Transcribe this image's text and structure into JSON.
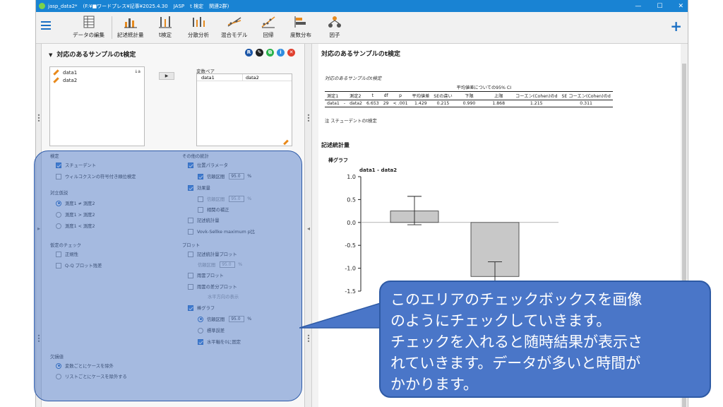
{
  "window": {
    "title_items": [
      "jasp_data2*",
      "(F:¥■ワードプレス¥記事¥2025.4.30",
      "JASP",
      "t 検定",
      "関連2群)"
    ],
    "controls": [
      "—",
      "☐",
      "✕"
    ]
  },
  "toolbar": {
    "items": [
      {
        "label": "データの編集",
        "icon": "data-edit-icon"
      },
      {
        "label": "記述統計量",
        "icon": "descriptives-icon"
      },
      {
        "label": "t検定",
        "icon": "ttest-icon"
      },
      {
        "label": "分散分析",
        "icon": "anova-icon"
      },
      {
        "label": "混合モデル",
        "icon": "mixed-model-icon"
      },
      {
        "label": "回帰",
        "icon": "regression-icon"
      },
      {
        "label": "度数分布",
        "icon": "frequencies-icon"
      },
      {
        "label": "因子",
        "icon": "factor-icon"
      }
    ],
    "plus": "+"
  },
  "analysis": {
    "title": "対応のあるサンプルのt検定",
    "header_icons": [
      "R",
      "✎",
      "⧉",
      "i",
      "✕"
    ],
    "variables": [
      "data1",
      "data2"
    ],
    "pair_label": "変数ペア",
    "pair": [
      "data1",
      "data2"
    ],
    "arrow": "▶",
    "sort_icon": "↓a"
  },
  "options": {
    "test_title": "検定",
    "student": "スチューデント",
    "wilcoxon": "ウィルコクスンの符号付き順位検定",
    "alt_title": "対立仮説",
    "alt1": "測度1 ≠ 測度2",
    "alt2": "測度1 > 測度2",
    "alt3": "測度1 < 測度2",
    "assump_title": "仮定のチェック",
    "normality": "正規性",
    "qq": "Q-Q プロット残差",
    "other_title": "その他の統計",
    "location": "位置パラメータ",
    "ci": "信頼区間",
    "ci_value": "95.0",
    "percent": "%",
    "effect": "効果量",
    "effect_ci": "信頼区間",
    "effect_ci_value": "95.0",
    "corr": "相関の補正",
    "descriptives": "記述統計量",
    "vovk": "Vovk-Sellke maximum p比",
    "plot_title": "プロット",
    "desc_plot": "記述統計量プロット",
    "desc_ci": "信頼区間",
    "desc_ci_value": "95.0",
    "raincloud": "雨雲プロット",
    "raincloud_diff": "雨雲の差分プロット",
    "horizontal": "水平方向の表示",
    "bar": "棒グラフ",
    "bar_ci": "信頼区間",
    "bar_ci_value": "95.0",
    "se": "標準誤差",
    "fix_axis": "水平軸を0に固定",
    "missing_title": "欠損値",
    "miss1": "変数ごとにケースを除外",
    "miss2": "リストごとにケースを除外する"
  },
  "results": {
    "title": "対応のあるサンプルのt検定",
    "table_caption": "対応のあるサンプルのt検定",
    "ci_header": "平均値差についての95% CI",
    "columns": [
      "測定1",
      "",
      "測定2",
      "t",
      "df",
      "p",
      "平均値差",
      "SEの違い",
      "下限",
      "上限",
      "コーエン(Cohen)のd",
      "SE コーエン(Cohen)のd"
    ],
    "row": [
      "data1",
      "-",
      "data2",
      "6.653",
      "29",
      "< .001",
      "1.429",
      "0.215",
      "0.990",
      "1.868",
      "1.215",
      "0.311"
    ],
    "note": "注 スチューデントのt検定",
    "descriptives_title": "記述統計量",
    "bar_title": "棒グラフ"
  },
  "chart_data": {
    "type": "bar",
    "title": "data1 - data2",
    "categories": [
      "",
      ""
    ],
    "values": [
      0.25,
      -1.18
    ],
    "errors": [
      [
        -0.05,
        0.57
      ],
      [
        -1.5,
        -0.86
      ]
    ],
    "yticks": [
      "1.0",
      "0.5",
      "0.0",
      "-0.5",
      "-1.0",
      "-1.5"
    ],
    "ylim": [
      -1.5,
      1.0
    ],
    "bar_color": "#c8c8c8"
  },
  "callout": {
    "lines": [
      "このエリアのチェックボックスを画像",
      "のようにチェックしていきます。",
      "チェックを入れると随時結果が表示さ",
      "れていきます。データが多いと時間が",
      "かかります。"
    ]
  },
  "colors": {
    "title_bar": "#1983d3",
    "accent": "#3d83d8",
    "overlay": "#406ec4",
    "callout": "#4a76c8"
  }
}
